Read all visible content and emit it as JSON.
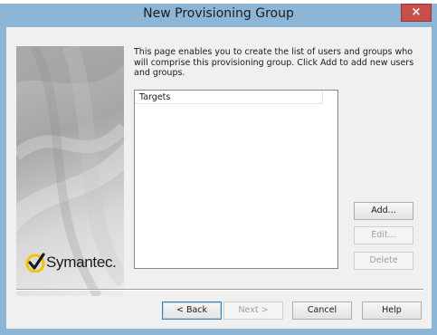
{
  "window": {
    "title": "New Provisioning Group",
    "close_glyph": "×"
  },
  "side_panel": {
    "logo_text": "Symantec.",
    "logo_icon": "checkmark-logo-icon"
  },
  "description": "This page enables you to create the list of users and groups who will comprise this provisioning group. Click Add to add new users and groups.",
  "targets": {
    "column_header": "Targets",
    "rows": []
  },
  "buttons": {
    "add": "Add...",
    "edit": "Edit...",
    "delete": "Delete",
    "back": "< Back",
    "next": "Next >",
    "cancel": "Cancel",
    "help": "Help"
  },
  "colors": {
    "titlebar": "#8db6d6",
    "close_button": "#c7504b",
    "client": "#f0f0f0",
    "logo_yellow": "#f2c500"
  }
}
